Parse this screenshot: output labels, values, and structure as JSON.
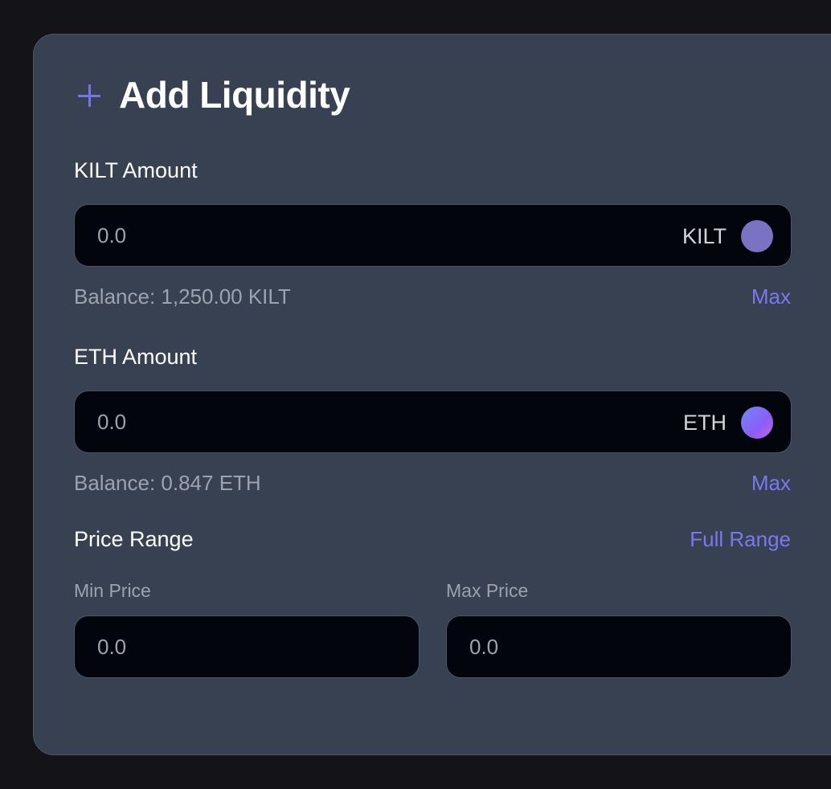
{
  "panel": {
    "title": "Add Liquidity",
    "icon": "plus-icon",
    "accent_color": "#7774e8"
  },
  "kilt": {
    "label": "KILT Amount",
    "value": "0.0",
    "token_symbol": "KILT",
    "token_color": "#7a72c2",
    "balance_text": "Balance: 1,250.00 KILT",
    "max_label": "Max"
  },
  "eth": {
    "label": "ETH Amount",
    "value": "0.0",
    "token_symbol": "ETH",
    "balance_text": "Balance: 0.847 ETH",
    "max_label": "Max"
  },
  "price_range": {
    "label": "Price Range",
    "full_range_label": "Full Range",
    "min": {
      "label": "Min Price",
      "value": "0.0"
    },
    "max": {
      "label": "Max Price",
      "value": "0.0"
    }
  }
}
